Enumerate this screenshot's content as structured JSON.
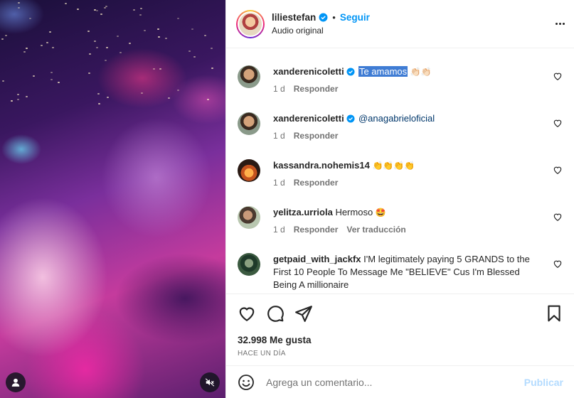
{
  "header": {
    "username": "liliestefan",
    "follow_label": "Seguir",
    "audio": "Audio original"
  },
  "comments": [
    {
      "username": "xanderenicoletti",
      "verified": true,
      "text": "Te amamos",
      "emoji": "👏🏻👏🏻",
      "time": "1 d",
      "reply": "Responder"
    },
    {
      "username": "xanderenicoletti",
      "verified": true,
      "text": "@anagabrieloficial",
      "emoji": "",
      "time": "1 d",
      "reply": "Responder"
    },
    {
      "username": "kassandra.nohemis14",
      "verified": false,
      "text": "",
      "emoji": "👏👏👏👏",
      "time": "1 d",
      "reply": "Responder"
    },
    {
      "username": "yelitza.urriola",
      "verified": false,
      "text": "Hermoso",
      "emoji": "🤩",
      "time": "1 d",
      "reply": "Responder",
      "translate": "Ver traducción"
    },
    {
      "username": "getpaid_with_jackfx",
      "verified": false,
      "text": "I'M legitimately paying 5 GRANDS to the First 10 People To Message Me \"BELIEVE\" Cus I'm Blessed Being A millionaire",
      "emoji": "",
      "time": "",
      "reply": ""
    }
  ],
  "likes": "32.998 Me gusta",
  "timestamp": "HACE UN DÍA",
  "add_comment": {
    "placeholder": "Agrega un comentario...",
    "publish_label": "Publicar"
  },
  "colors": {
    "accent": "#0095f6",
    "publish_disabled": "#b3dbff",
    "highlight": "#3f7cd4"
  }
}
